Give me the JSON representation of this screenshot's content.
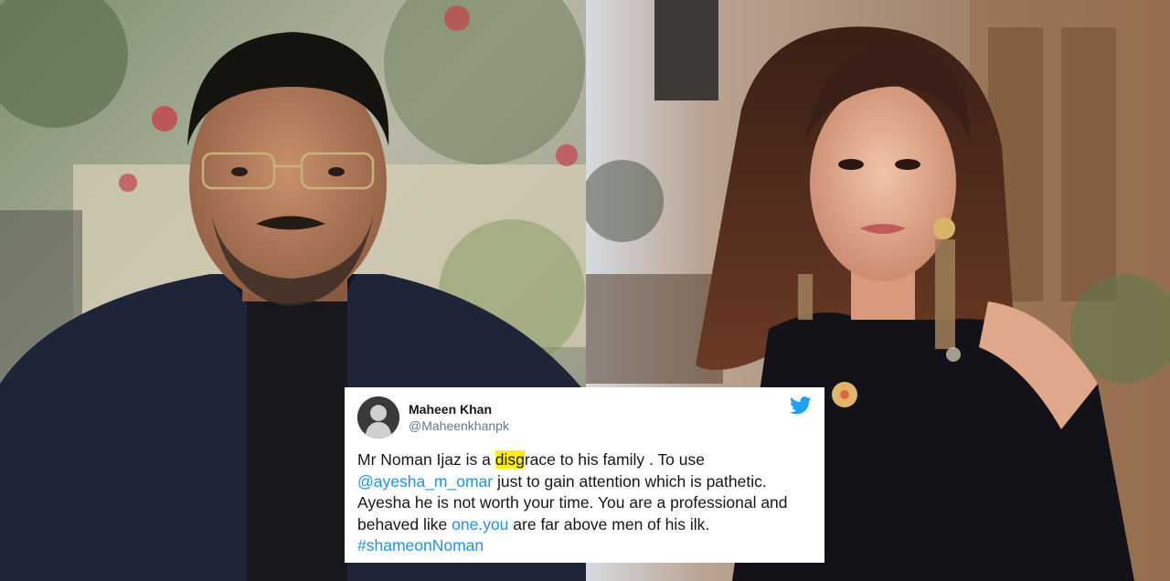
{
  "tweet": {
    "display_name": "Maheen Khan",
    "handle": "@Maheenkhanpk",
    "text": {
      "p1": "Mr Noman Ijaz is a ",
      "highlight": "disg",
      "p2": "race to his family . To use ",
      "mention": "@ayesha_m_omar",
      "p3": " just to gain attention which is pathetic. Ayesha he is not worth your time. You are a professional and behaved like ",
      "link": "one.you",
      "p4": " are far above men of his ilk. ",
      "hashtag": "#shameonNoman"
    }
  },
  "colors": {
    "twitter_blue": "#1da1f2",
    "link_blue": "#1b95e0",
    "highlight_yellow": "#fff200"
  },
  "icons": {
    "brand": "twitter-bird-icon"
  }
}
